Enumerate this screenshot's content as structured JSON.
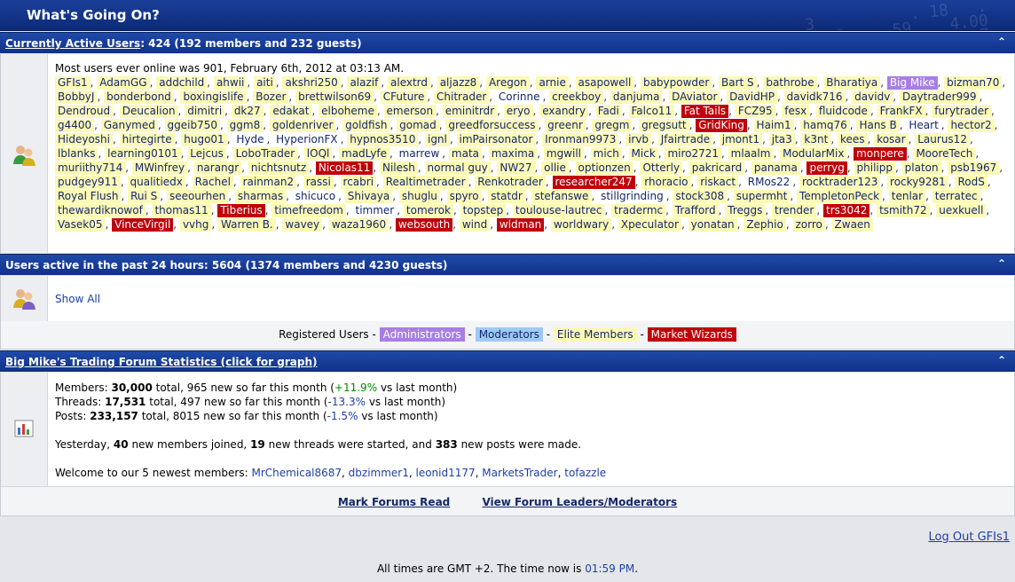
{
  "header": {
    "title": "What's Going On?"
  },
  "active": {
    "link": "Currently Active Users",
    "summary": ": 424 (192 members and 232 guests)",
    "most_online": "Most users ever online was 901, February 6th, 2012 at 03:13 AM.",
    "users": [
      {
        "n": "GFIs1",
        "t": "e"
      },
      {
        "n": "AdamGG",
        "t": "e"
      },
      {
        "n": "addchild",
        "t": "e"
      },
      {
        "n": "ahwii",
        "t": "e"
      },
      {
        "n": "aiti",
        "t": "e"
      },
      {
        "n": "akshri250",
        "t": "e"
      },
      {
        "n": "alazif",
        "t": "e"
      },
      {
        "n": "alextrd",
        "t": "e"
      },
      {
        "n": "aljazz8",
        "t": "e"
      },
      {
        "n": "Aregon",
        "t": "e"
      },
      {
        "n": "arnie",
        "t": "e"
      },
      {
        "n": "asapowell",
        "t": "e"
      },
      {
        "n": "babypowder",
        "t": "e"
      },
      {
        "n": "Bart S",
        "t": "e"
      },
      {
        "n": "bathrobe",
        "t": "e"
      },
      {
        "n": "Bharatiya",
        "t": "e"
      },
      {
        "n": "Big Mike",
        "t": "a"
      },
      {
        "n": "bizman70",
        "t": "e"
      },
      {
        "n": "BobbyJ",
        "t": "e"
      },
      {
        "n": "bonderbond",
        "t": "e"
      },
      {
        "n": "boxingislife",
        "t": "e"
      },
      {
        "n": "Bozer",
        "t": "e"
      },
      {
        "n": "brettwilson69",
        "t": "e"
      },
      {
        "n": "CFuture",
        "t": "e"
      },
      {
        "n": "Chitrader",
        "t": "e"
      },
      {
        "n": "Corinne",
        "t": "p"
      },
      {
        "n": "creekboy",
        "t": "e"
      },
      {
        "n": "danjuma",
        "t": "e"
      },
      {
        "n": "DAviator",
        "t": "e"
      },
      {
        "n": "DavidHP",
        "t": "e"
      },
      {
        "n": "davidk716",
        "t": "e"
      },
      {
        "n": "davidv",
        "t": "e"
      },
      {
        "n": "Daytrader999",
        "t": "e"
      },
      {
        "n": "Dendroud",
        "t": "e"
      },
      {
        "n": "Deucalion",
        "t": "e"
      },
      {
        "n": "dimitri",
        "t": "e"
      },
      {
        "n": "dk27",
        "t": "e"
      },
      {
        "n": "edakat",
        "t": "e"
      },
      {
        "n": "elboheme",
        "t": "e"
      },
      {
        "n": "emerson",
        "t": "e"
      },
      {
        "n": "eminitrdr",
        "t": "e"
      },
      {
        "n": "eryo",
        "t": "e"
      },
      {
        "n": "exandry",
        "t": "e"
      },
      {
        "n": "Fadi",
        "t": "e"
      },
      {
        "n": "Falco11",
        "t": "e"
      },
      {
        "n": "Fat Tails",
        "t": "m"
      },
      {
        "n": "FCZ95",
        "t": "e"
      },
      {
        "n": "fesx",
        "t": "e"
      },
      {
        "n": "fluidcode",
        "t": "e"
      },
      {
        "n": "FrankFX",
        "t": "e"
      },
      {
        "n": "furytrader",
        "t": "e"
      },
      {
        "n": "g4400",
        "t": "e"
      },
      {
        "n": "Ganymed",
        "t": "e"
      },
      {
        "n": "ggeib750",
        "t": "e"
      },
      {
        "n": "ggm8",
        "t": "e"
      },
      {
        "n": "goldenriver",
        "t": "e"
      },
      {
        "n": "goldfish",
        "t": "e"
      },
      {
        "n": "gomad",
        "t": "e"
      },
      {
        "n": "greedforsuccess",
        "t": "e"
      },
      {
        "n": "greenr",
        "t": "e"
      },
      {
        "n": "gregm",
        "t": "e"
      },
      {
        "n": "gregsutt",
        "t": "e"
      },
      {
        "n": "GridKing",
        "t": "m"
      },
      {
        "n": "Haim1",
        "t": "e"
      },
      {
        "n": "hamq76",
        "t": "e"
      },
      {
        "n": "Hans B",
        "t": "e"
      },
      {
        "n": "Heart",
        "t": "p"
      },
      {
        "n": "hector2",
        "t": "e"
      },
      {
        "n": "Hideyoshi",
        "t": "e"
      },
      {
        "n": "hirtegirte",
        "t": "e"
      },
      {
        "n": "hugo01",
        "t": "e"
      },
      {
        "n": "Hyde",
        "t": "p"
      },
      {
        "n": "HyperionFX",
        "t": "p"
      },
      {
        "n": "hypnos3510",
        "t": "e"
      },
      {
        "n": "ignl",
        "t": "e"
      },
      {
        "n": "imPairsonator",
        "t": "e"
      },
      {
        "n": "Ironman9973",
        "t": "e"
      },
      {
        "n": "irvb",
        "t": "e"
      },
      {
        "n": "Jfairtrade",
        "t": "e"
      },
      {
        "n": "jmont1",
        "t": "e"
      },
      {
        "n": "jta3",
        "t": "e"
      },
      {
        "n": "k3nt",
        "t": "e"
      },
      {
        "n": "kees",
        "t": "e"
      },
      {
        "n": "kosar",
        "t": "e"
      },
      {
        "n": "Laurus12",
        "t": "e"
      },
      {
        "n": "lblanks",
        "t": "e"
      },
      {
        "n": "learning0101",
        "t": "e"
      },
      {
        "n": "Lejcus",
        "t": "e"
      },
      {
        "n": "LoboTrader",
        "t": "e"
      },
      {
        "n": "lOQl",
        "t": "e"
      },
      {
        "n": "madLyfe",
        "t": "e"
      },
      {
        "n": "marrew",
        "t": "p"
      },
      {
        "n": "mata",
        "t": "e"
      },
      {
        "n": "maxima",
        "t": "e"
      },
      {
        "n": "mgwill",
        "t": "e"
      },
      {
        "n": "mich",
        "t": "e"
      },
      {
        "n": "Mick",
        "t": "e"
      },
      {
        "n": "miro2721",
        "t": "e"
      },
      {
        "n": "mlaalm",
        "t": "e"
      },
      {
        "n": "ModularMix",
        "t": "e"
      },
      {
        "n": "monpere",
        "t": "m"
      },
      {
        "n": "MooreTech",
        "t": "e"
      },
      {
        "n": "muriithy714",
        "t": "e"
      },
      {
        "n": "MWinfrey",
        "t": "e"
      },
      {
        "n": "narangr",
        "t": "e"
      },
      {
        "n": "nichtsnutz",
        "t": "e"
      },
      {
        "n": "Nicolas11",
        "t": "m"
      },
      {
        "n": "Nilesh",
        "t": "e"
      },
      {
        "n": "normal guy",
        "t": "e"
      },
      {
        "n": "NW27",
        "t": "e"
      },
      {
        "n": "ollie",
        "t": "e"
      },
      {
        "n": "optionzen",
        "t": "e"
      },
      {
        "n": "Otterly",
        "t": "e"
      },
      {
        "n": "pakricard",
        "t": "e"
      },
      {
        "n": "panama",
        "t": "e"
      },
      {
        "n": "perryg",
        "t": "m"
      },
      {
        "n": "philipp",
        "t": "e"
      },
      {
        "n": "platon",
        "t": "e"
      },
      {
        "n": "psb1967",
        "t": "e"
      },
      {
        "n": "pudgey911",
        "t": "e"
      },
      {
        "n": "qualitiedx",
        "t": "e"
      },
      {
        "n": "Rachel",
        "t": "e"
      },
      {
        "n": "rainman2",
        "t": "e"
      },
      {
        "n": "rassi",
        "t": "e"
      },
      {
        "n": "rcabri",
        "t": "e"
      },
      {
        "n": "Realtimetrader",
        "t": "e"
      },
      {
        "n": "Renkotrader",
        "t": "e"
      },
      {
        "n": "researcher247",
        "t": "m"
      },
      {
        "n": "rhoracio",
        "t": "e"
      },
      {
        "n": "riskact",
        "t": "e"
      },
      {
        "n": "RMos22",
        "t": "p"
      },
      {
        "n": "rocktrader123",
        "t": "e"
      },
      {
        "n": "rocky9281",
        "t": "e"
      },
      {
        "n": "RodS",
        "t": "e"
      },
      {
        "n": "Royal Flush",
        "t": "e"
      },
      {
        "n": "Rui S",
        "t": "e"
      },
      {
        "n": "seeourhen",
        "t": "e"
      },
      {
        "n": "sharmas",
        "t": "e"
      },
      {
        "n": "shicuco",
        "t": "p"
      },
      {
        "n": "Shivaya",
        "t": "e"
      },
      {
        "n": "shuglu",
        "t": "e"
      },
      {
        "n": "spyro",
        "t": "e"
      },
      {
        "n": "statdr",
        "t": "e"
      },
      {
        "n": "stefanswe",
        "t": "e"
      },
      {
        "n": "stillgrinding",
        "t": "p"
      },
      {
        "n": "stock308",
        "t": "e"
      },
      {
        "n": "supermht",
        "t": "e"
      },
      {
        "n": "TempletonPeck",
        "t": "e"
      },
      {
        "n": "tenlar",
        "t": "e"
      },
      {
        "n": "terratec",
        "t": "e"
      },
      {
        "n": "thewardiknowof",
        "t": "e"
      },
      {
        "n": "thomas11",
        "t": "e"
      },
      {
        "n": "Tiberius",
        "t": "m"
      },
      {
        "n": "timefreedom",
        "t": "e"
      },
      {
        "n": "timmer",
        "t": "p"
      },
      {
        "n": "tomerok",
        "t": "e"
      },
      {
        "n": "topstep",
        "t": "e"
      },
      {
        "n": "toulouse-lautrec",
        "t": "e"
      },
      {
        "n": "tradermc",
        "t": "e"
      },
      {
        "n": "Trafford",
        "t": "e"
      },
      {
        "n": "Treggs",
        "t": "e"
      },
      {
        "n": "trender",
        "t": "e"
      },
      {
        "n": "trs3042",
        "t": "m"
      },
      {
        "n": "tsmith72",
        "t": "e"
      },
      {
        "n": "uexkuell",
        "t": "e"
      },
      {
        "n": "Vasek05",
        "t": "e"
      },
      {
        "n": "VinceVirgil",
        "t": "m"
      },
      {
        "n": "vvhg",
        "t": "e"
      },
      {
        "n": "Warren B.",
        "t": "e"
      },
      {
        "n": "wavey",
        "t": "e"
      },
      {
        "n": "waza1960",
        "t": "e"
      },
      {
        "n": "websouth",
        "t": "m"
      },
      {
        "n": "wind",
        "t": "e"
      },
      {
        "n": "wldman",
        "t": "m"
      },
      {
        "n": "worldwary",
        "t": "e"
      },
      {
        "n": "Xpeculator",
        "t": "e"
      },
      {
        "n": "yonatan",
        "t": "e"
      },
      {
        "n": "Zephio",
        "t": "e"
      },
      {
        "n": "zorro",
        "t": "e"
      },
      {
        "n": "Zwaen",
        "t": "e"
      }
    ],
    "separator": ","
  },
  "past24": {
    "heading": "Users active in the past 24 hours: 5604 (1374 members and 4230 guests)",
    "show_all": "Show All"
  },
  "legend": {
    "prefix": "Registered Users -",
    "dash": "-",
    "administrators": "Administrators",
    "moderators": "Moderators",
    "elite": "Elite Members",
    "market_wizards": "Market Wizards"
  },
  "stats": {
    "link": "Big Mike's Trading Forum Statistics (click for graph)",
    "members_label": "Members:",
    "members_total": "30,000",
    "members_rest": "total, 965 new so far this month (",
    "members_pct": "+11.9%",
    "members_end": "vs last month)",
    "threads_label": "Threads:",
    "threads_total": "17,531",
    "threads_rest": "total, 497 new so far this month (",
    "threads_pct": "-13.3%",
    "threads_end": "vs last month)",
    "posts_label": "Posts:",
    "posts_total": "233,157",
    "posts_rest": "total, 8015 new so far this month (",
    "posts_pct": "-1.5%",
    "posts_end": "vs last month)",
    "y_pre": "Yesterday,",
    "y_members": "40",
    "y_mid1": "new members joined,",
    "y_threads": "19",
    "y_mid2": "new threads were started, and",
    "y_posts": "383",
    "y_end": "new posts were made.",
    "welcome": "Welcome to our 5 newest members:",
    "newest": [
      "MrChemical8687",
      "dbzimmer1",
      "leonid1177",
      "MarketsTrader",
      "tofazzle"
    ]
  },
  "footer": {
    "mark_read": "Mark Forums Read",
    "leaders": "View Forum Leaders/Moderators",
    "logout": "Log Out GFIs1",
    "times_pre": "All times are GMT +2. The time now is",
    "time_now": "01:59 PM",
    "times_post": "."
  },
  "colors": {
    "header_blue": "#10318a",
    "elite": "#fcf9b6",
    "admin": "#a77ee6",
    "moderator": "#9ec9f4",
    "market_wizard": "#c0000a"
  },
  "icons": {
    "users": "users-icon",
    "stats": "stats-chart-icon",
    "collapse": "collapse-icon"
  }
}
